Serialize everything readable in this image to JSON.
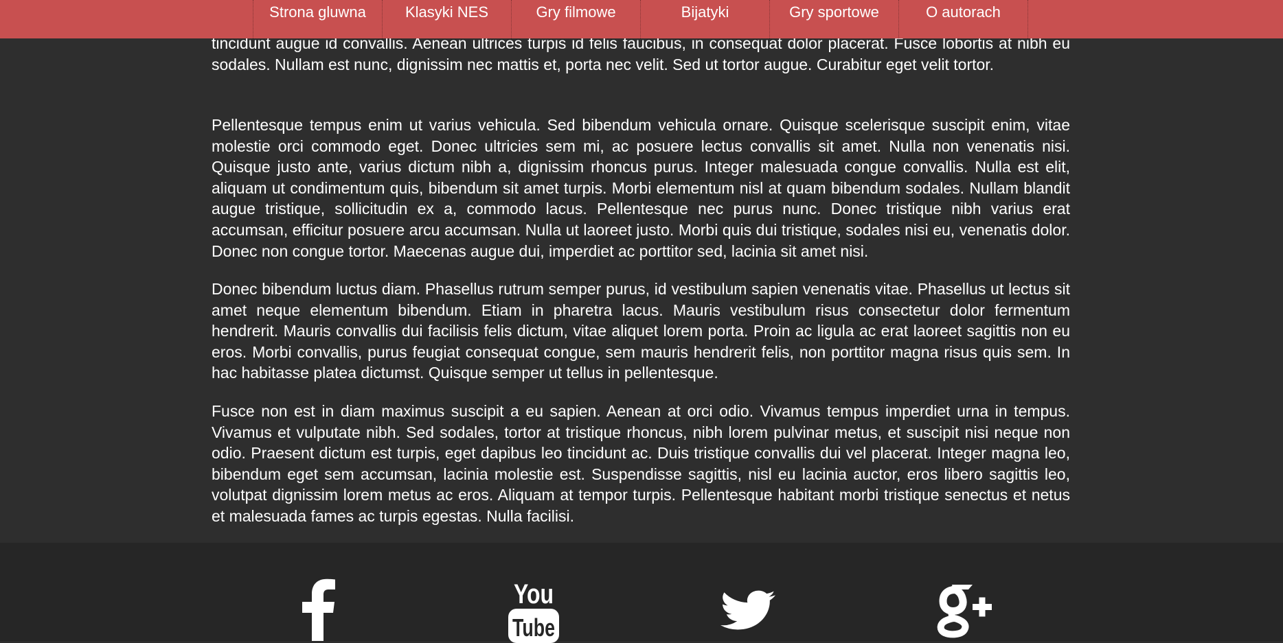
{
  "nav": {
    "items": [
      {
        "label": "Strona gluwna"
      },
      {
        "label": "Klasyki NES"
      },
      {
        "label": "Gry filmowe"
      },
      {
        "label": "Bijatyki"
      },
      {
        "label": "Gry sportowe"
      },
      {
        "label": "O autorach"
      }
    ]
  },
  "content": {
    "paragraphs": [
      "tincidunt augue id convallis. Aenean ultrices turpis id felis faucibus, in consequat dolor placerat. Fusce lobortis at nibh eu sodales. Nullam est nunc, dignissim nec mattis et, porta nec velit. Sed ut tortor augue. Curabitur eget velit tortor.",
      "Pellentesque tempus enim ut varius vehicula. Sed bibendum vehicula ornare. Quisque scelerisque suscipit enim, vitae molestie orci commodo eget. Donec ultricies sem mi, ac posuere lectus convallis sit amet. Nulla non venenatis nisi. Quisque justo ante, varius dictum nibh a, dignissim rhoncus purus. Integer malesuada congue convallis. Nulla est elit, aliquam ut condimentum quis, bibendum sit amet turpis. Morbi elementum nisl at quam bibendum sodales. Nullam blandit augue tristique, sollicitudin ex a, commodo lacus. Pellentesque nec purus nunc. Donec tristique nibh varius erat accumsan, efficitur posuere arcu accumsan. Nulla ut laoreet justo. Morbi quis dui tristique, sodales nisi eu, venenatis dolor. Donec non congue tortor. Maecenas augue dui, imperdiet ac porttitor sed, lacinia sit amet nisi.",
      "Donec bibendum luctus diam. Phasellus rutrum semper purus, id vestibulum sapien venenatis vitae. Phasellus ut lectus sit amet neque elementum bibendum. Etiam in pharetra lacus. Mauris vestibulum risus consectetur dolor fermentum hendrerit. Mauris convallis dui facilisis felis dictum, vitae aliquet lorem porta. Proin ac ligula ac erat laoreet sagittis non eu eros. Morbi convallis, purus feugiat consequat congue, sem mauris hendrerit felis, non porttitor magna risus quis sem. In hac habitasse platea dictumst. Quisque semper ut tellus in pellentesque.",
      "Fusce non est in diam maximus suscipit a eu sapien. Aenean at orci odio. Vivamus tempus imperdiet urna in tempus. Vivamus et vulputate nibh. Sed sodales, tortor at tristique rhoncus, nibh lorem pulvinar metus, et suscipit nisi neque non odio. Praesent dictum est turpis, eget dapibus leo tincidunt ac. Duis tristique convallis dui vel placerat. Integer magna leo, bibendum eget sem accumsan, lacinia molestie est. Suspendisse sagittis, nisl eu lacinia auctor, eros libero sagittis leo, volutpat dignissim lorem metus ac eros. Aliquam at tempor turpis. Pellentesque habitant morbi tristique senectus et netus et malesuada fames ac turpis egestas. Nulla facilisi."
    ]
  },
  "footer": {
    "social": [
      {
        "icon": "facebook-icon"
      },
      {
        "icon": "youtube-icon",
        "label_top": "You",
        "label_bottom": "Tube"
      },
      {
        "icon": "twitter-icon"
      },
      {
        "icon": "google-plus-icon"
      }
    ]
  },
  "colors": {
    "nav_background": "#c85050",
    "page_background": "#2e2e2e",
    "footer_background": "#262626",
    "text": "#ffffff"
  }
}
